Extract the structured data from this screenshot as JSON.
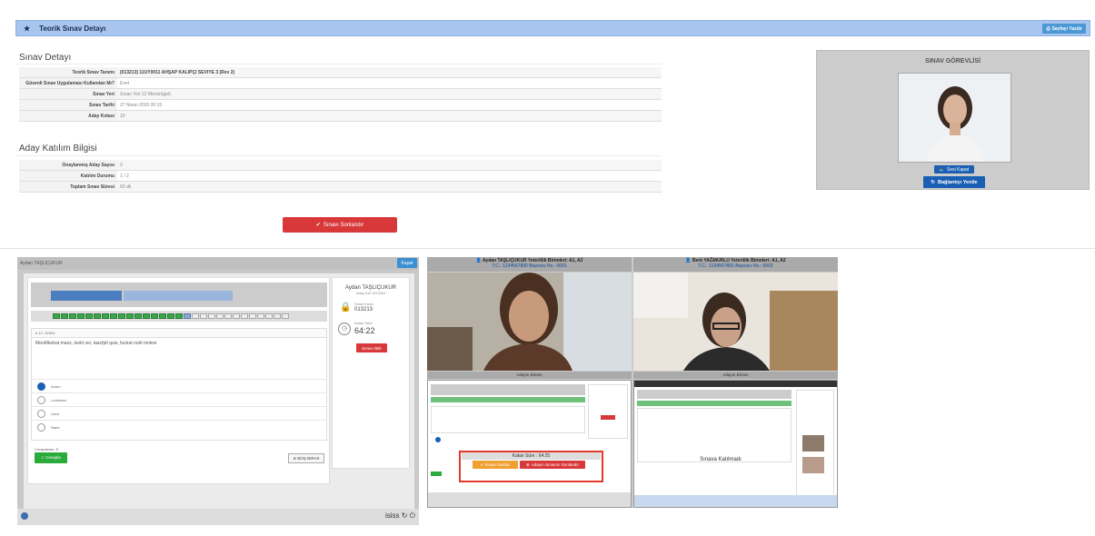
{
  "header": {
    "title": "Teorik Sınav Detayı",
    "print_label": "Sayfayı Yazdır"
  },
  "exam_detail": {
    "title": "Sınav Detayı",
    "rows": [
      {
        "k": "Teorik Sınav Tanımı",
        "v": "(013213) 11UY0011 AHŞAP KALIPÇI SEVIYE 3 (Rev 2)"
      },
      {
        "k": "Güvenli Sınav Uygulaması Kullanılan Mı?",
        "v": "Evet"
      },
      {
        "k": "Sınav Yeri",
        "v": "Sınav Yeri 12 Mersin(gel)"
      },
      {
        "k": "Sınav Tarihi",
        "v": "27 Nisan 2020 20:15"
      },
      {
        "k": "Aday Kotası",
        "v": "10"
      }
    ]
  },
  "participation": {
    "title": "Aday Katılım Bilgisi",
    "rows": [
      {
        "k": "Onaylanmış Aday Sayısı",
        "v": "2"
      },
      {
        "k": "Katılım Durumu",
        "v": "1 / 2"
      },
      {
        "k": "Toplam Sınav Süresi",
        "v": "60 dk"
      }
    ]
  },
  "end_button": "Sınavı Sonlandır",
  "officer": {
    "title": "SINAV GÖREVLİSİ",
    "mute": "Sesi Kapat",
    "refresh": "Bağlantıyı Yenile"
  },
  "left_panel": {
    "name": "Aydan TAŞLIÇUKUR",
    "close": "Kapat",
    "question_label": "# 12. SORU",
    "question_text": "Meráfikebat maez, tsokt vei, taacfpit quis, fusirat nodi molesi",
    "options": [
      "Ameo",
      "Lorehasa",
      "Unus",
      "Naes"
    ],
    "answered": "Cevaplanan: 8",
    "answer_btn": "✓ Cevapla",
    "skip_btn": "⊘ BOŞ BIRAK",
    "side_name": "Aydan TAŞLIÇUKUR",
    "side_sub": "Aday Adı SOYADI",
    "code_label": "Sınav Kodu",
    "code": "013213",
    "time_label": "Kalan Süre",
    "time": "64:22",
    "exit": "Sınavı Bitir",
    "footer_icons": "isiss ↻ ⏻"
  },
  "right_panel": {
    "cand1": {
      "name": "Aydan TAŞLIÇUKUR  Yeterlilik Birimleri: A1, A2",
      "sub": "T.C.: 1234567890  Başvuru No.: 0001"
    },
    "cand2": {
      "name": "Berk YAĞMURLU  Yeterlilik Birimleri: A1, A2",
      "sub": "T.C.: 1234567891  Başvuru No.: 0002"
    },
    "screen_cap": "Adayın Ekranı",
    "remaining": "Kalan Süre : 64:25",
    "pause": "Sınavı Durdur",
    "end_cand": "Adayın Sınavını Sonlandır",
    "not_joined": "Sınava Katılmadı"
  },
  "colors": {
    "header_bg": "#a8c5ef",
    "danger": "#d9383a",
    "primary": "#1a5fb4",
    "success": "#2aab3c"
  }
}
